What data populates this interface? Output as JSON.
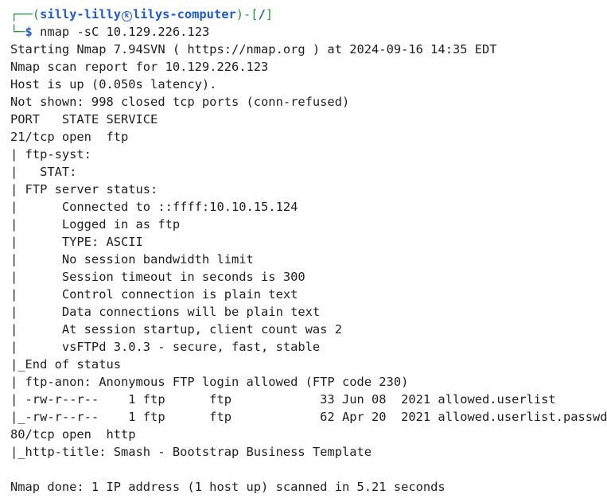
{
  "prompt": {
    "corner_top": "┌──(",
    "user": "silly-lilly",
    "skull_glyph": "k",
    "host": "lilys-computer",
    "close_paren_dash": ")-[",
    "path": "/",
    "close_bracket": "]",
    "corner_bottom": "└─",
    "symbol": "$",
    "command": "nmap -sC 10.129.226.123"
  },
  "output": [
    "Starting Nmap 7.94SVN ( https://nmap.org ) at 2024-09-16 14:35 EDT",
    "Nmap scan report for 10.129.226.123",
    "Host is up (0.050s latency).",
    "Not shown: 998 closed tcp ports (conn-refused)",
    "PORT   STATE SERVICE",
    "21/tcp open  ftp",
    "| ftp-syst:",
    "|   STAT:",
    "| FTP server status:",
    "|      Connected to ::ffff:10.10.15.124",
    "|      Logged in as ftp",
    "|      TYPE: ASCII",
    "|      No session bandwidth limit",
    "|      Session timeout in seconds is 300",
    "|      Control connection is plain text",
    "|      Data connections will be plain text",
    "|      At session startup, client count was 2",
    "|      vsFTPd 3.0.3 - secure, fast, stable",
    "|_End of status",
    "| ftp-anon: Anonymous FTP login allowed (FTP code 230)",
    "| -rw-r--r--    1 ftp      ftp            33 Jun 08  2021 allowed.userlist",
    "|_-rw-r--r--    1 ftp      ftp            62 Apr 20  2021 allowed.userlist.passwd",
    "80/tcp open  http",
    "|_http-title: Smash - Bootstrap Business Template",
    "",
    "Nmap done: 1 IP address (1 host up) scanned in 5.21 seconds"
  ],
  "colors": {
    "prompt_frame": "#1f9a3c",
    "prompt_user_host": "#1f5bd6",
    "text": "#1f1f1f",
    "background": "#ffffff"
  }
}
